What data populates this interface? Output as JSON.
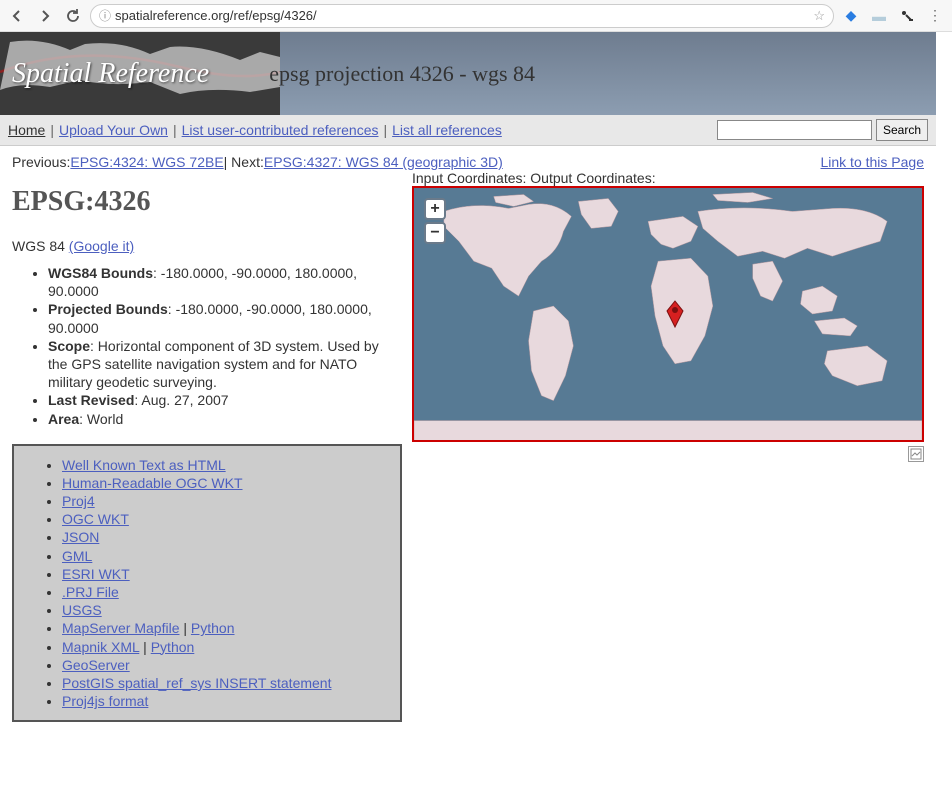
{
  "browser": {
    "url": "spatialreference.org/ref/epsg/4326/"
  },
  "header": {
    "site_title": "Spatial Reference",
    "page_title": "epsg projection 4326 - wgs 84"
  },
  "nav": {
    "home": "Home",
    "upload": "Upload Your Own",
    "list_user": "List user-contributed references",
    "list_all": "List all references",
    "search_btn": "Search"
  },
  "prevnext": {
    "prev_label": "Previous: ",
    "prev_link": "EPSG:4324: WGS 72BE",
    "next_label": " | Next: ",
    "next_link": "EPSG:4327: WGS 84 (geographic 3D)",
    "permalink": "Link to this Page"
  },
  "content": {
    "code": "EPSG:4326",
    "name": "WGS 84 ",
    "google_it": "(Google it)"
  },
  "props": {
    "wgs84_label": "WGS84 Bounds",
    "wgs84_val": ": -180.0000, -90.0000, 180.0000, 90.0000",
    "proj_label": "Projected Bounds",
    "proj_val": ": -180.0000, -90.0000, 180.0000, 90.0000",
    "scope_label": "Scope",
    "scope_val": ": Horizontal component of 3D system. Used by the GPS satellite navigation system and for NATO military geodetic surveying.",
    "revised_label": "Last Revised",
    "revised_val": ": Aug. 27, 2007",
    "area_label": "Area",
    "area_val": ": World"
  },
  "formats": {
    "wkt_html": "Well Known Text as HTML",
    "hr_ogc_wkt": "Human-Readable OGC WKT",
    "proj4": "Proj4",
    "ogc_wkt": "OGC WKT",
    "json": "JSON",
    "gml": "GML",
    "esri_wkt": "ESRI WKT",
    "prj": ".PRJ File",
    "usgs": "USGS",
    "mapserver": "MapServer Mapfile",
    "mapserver_py": "Python",
    "mapnik": "Mapnik XML",
    "mapnik_py": "Python",
    "geoserver": "GeoServer",
    "postgis": "PostGIS spatial_ref_sys INSERT statement",
    "proj4js": "Proj4js format"
  },
  "map": {
    "input_label": "Input Coordinates: ",
    "output_label": "Output Coordinates:"
  }
}
